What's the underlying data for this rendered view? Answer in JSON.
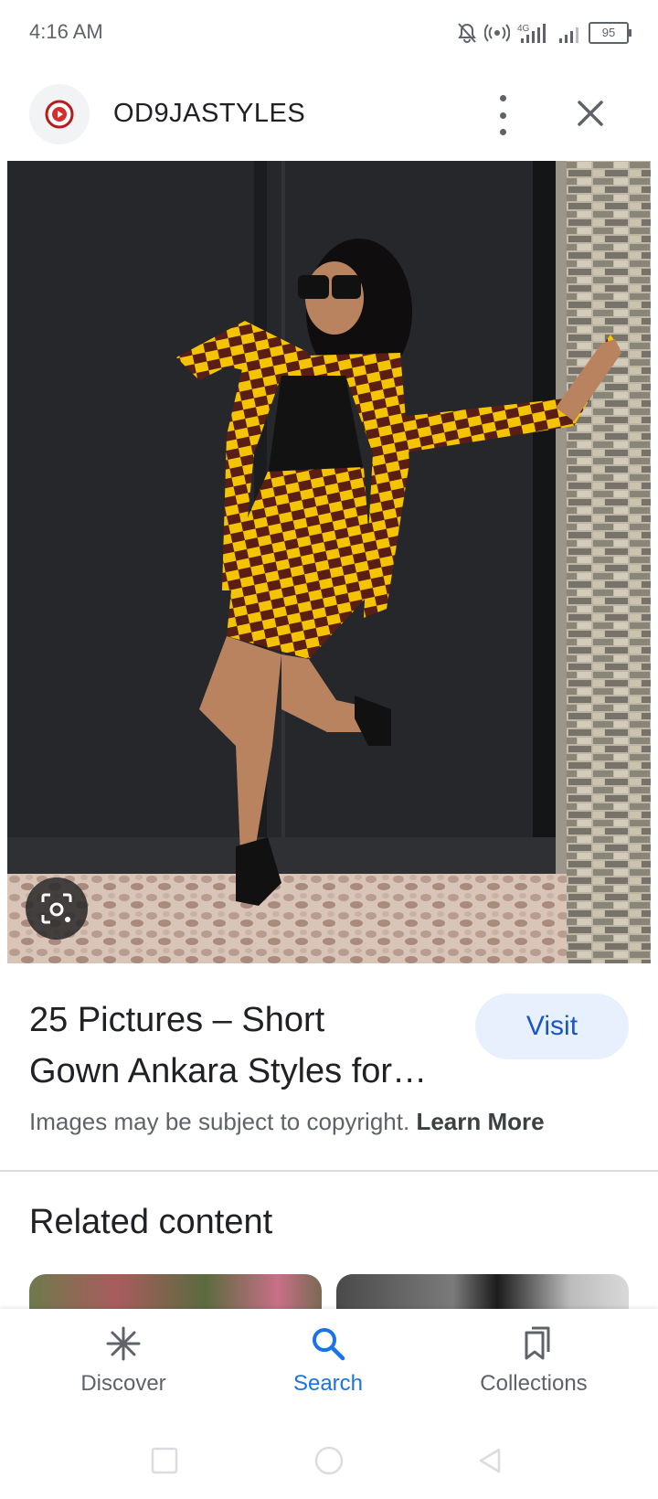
{
  "status_bar": {
    "time": "4:16 AM",
    "network": "4G",
    "battery": "95"
  },
  "header": {
    "source_name": "OD9JASTYLES",
    "more_icon": "more-vert-icon",
    "close_icon": "close-icon"
  },
  "result": {
    "title_line1": "25 Pictures – Short",
    "title_line2": "Gown Ankara Styles for…",
    "visit_label": "Visit",
    "copyright_text": "Images may be subject to copyright.",
    "learn_more": "Learn More"
  },
  "related": {
    "heading": "Related content"
  },
  "bottom_nav": {
    "items": [
      {
        "label": "Discover",
        "icon": "asterisk-icon"
      },
      {
        "label": "Search",
        "icon": "search-icon",
        "active": true
      },
      {
        "label": "Collections",
        "icon": "bookmarks-icon"
      }
    ]
  },
  "colors": {
    "accent": "#1a73e8",
    "visit_bg": "#e8f0fe",
    "text_primary": "#202124",
    "text_secondary": "#5f6368"
  }
}
